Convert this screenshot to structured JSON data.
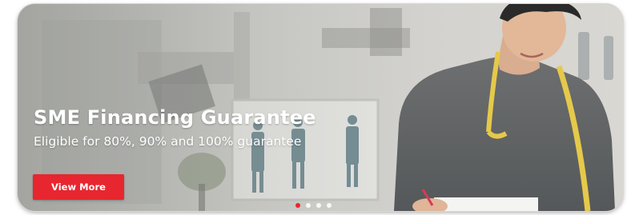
{
  "banner": {
    "title": "SME Financing Guarantee",
    "subtitle": "Eligible for 80%, 90% and 100% guarantee",
    "cta_label": "View More",
    "accent_color": "#e8262f",
    "slides_count": 4,
    "active_slide": 1
  }
}
